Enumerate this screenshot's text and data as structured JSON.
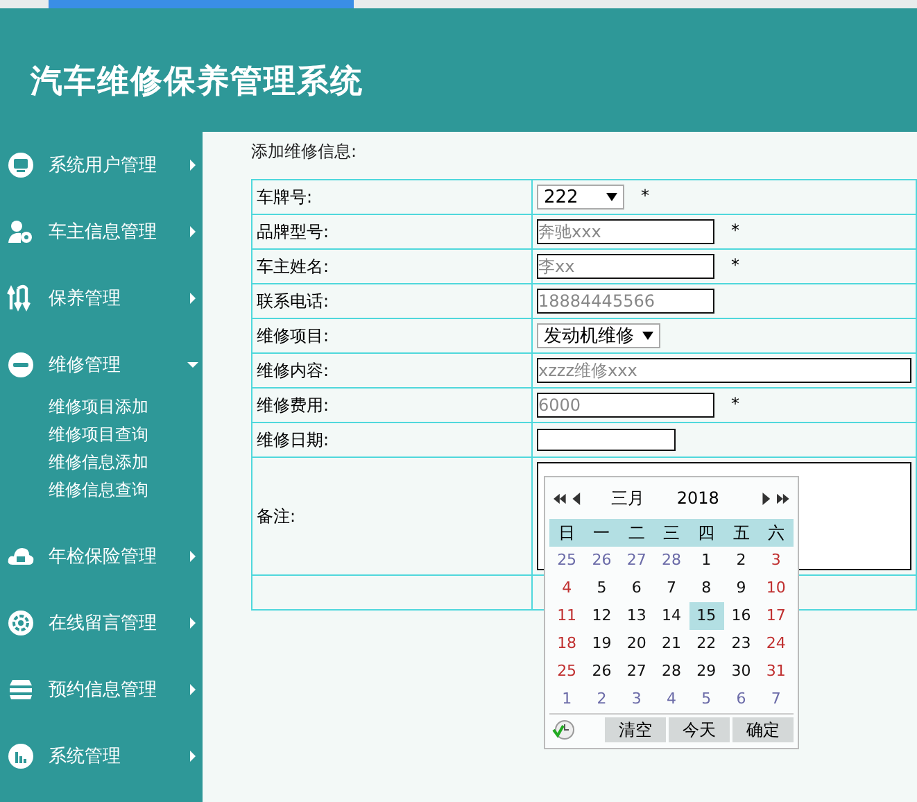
{
  "header": {
    "title": "汽车维修保养管理系统"
  },
  "sidebar": {
    "items": [
      {
        "label": "系统用户管理",
        "expanded": false
      },
      {
        "label": "车主信息管理",
        "expanded": false
      },
      {
        "label": "保养管理",
        "expanded": false
      },
      {
        "label": "维修管理",
        "expanded": true,
        "children": [
          "维修项目添加",
          "维修项目查询",
          "维修信息添加",
          "维修信息查询"
        ]
      },
      {
        "label": "年检保险管理",
        "expanded": false
      },
      {
        "label": "在线留言管理",
        "expanded": false
      },
      {
        "label": "预约信息管理",
        "expanded": false
      },
      {
        "label": "系统管理",
        "expanded": false
      }
    ]
  },
  "form": {
    "heading": "添加维修信息:",
    "rows": [
      {
        "label": "车牌号:",
        "kind": "select",
        "value": "222",
        "mark": "*"
      },
      {
        "label": "品牌型号:",
        "kind": "text",
        "placeholder": "奔驰xxx",
        "mark": "*"
      },
      {
        "label": "车主姓名:",
        "kind": "text",
        "placeholder": "李xx",
        "mark": "*"
      },
      {
        "label": "联系电话:",
        "kind": "text",
        "placeholder": "18884445566"
      },
      {
        "label": "维修项目:",
        "kind": "select",
        "value": "发动机维修"
      },
      {
        "label": "维修内容:",
        "kind": "wide",
        "placeholder": "xzzz维修xxx"
      },
      {
        "label": "维修费用:",
        "kind": "text",
        "placeholder": "6000",
        "mark": "*"
      },
      {
        "label": "维修日期:",
        "kind": "date"
      },
      {
        "label": "备注:",
        "kind": "textarea"
      },
      {
        "kind": "empty"
      }
    ]
  },
  "calendar": {
    "month": "三月",
    "year": "2018",
    "weekdays": [
      "日",
      "一",
      "二",
      "三",
      "四",
      "五",
      "六"
    ],
    "days": [
      {
        "text": "25",
        "kind": "other",
        "selected": false
      },
      {
        "text": "26",
        "kind": "other",
        "selected": false
      },
      {
        "text": "27",
        "kind": "other",
        "selected": false
      },
      {
        "text": "28",
        "kind": "other",
        "selected": false
      },
      {
        "text": "1",
        "kind": "day",
        "selected": false
      },
      {
        "text": "2",
        "kind": "day",
        "selected": false
      },
      {
        "text": "3",
        "kind": "weekend",
        "selected": false
      },
      {
        "text": "4",
        "kind": "weekend",
        "selected": false
      },
      {
        "text": "5",
        "kind": "day",
        "selected": false
      },
      {
        "text": "6",
        "kind": "day",
        "selected": false
      },
      {
        "text": "7",
        "kind": "day",
        "selected": false
      },
      {
        "text": "8",
        "kind": "day",
        "selected": false
      },
      {
        "text": "9",
        "kind": "day",
        "selected": false
      },
      {
        "text": "10",
        "kind": "weekend",
        "selected": false
      },
      {
        "text": "11",
        "kind": "weekend",
        "selected": false
      },
      {
        "text": "12",
        "kind": "day",
        "selected": false
      },
      {
        "text": "13",
        "kind": "day",
        "selected": false
      },
      {
        "text": "14",
        "kind": "day",
        "selected": false
      },
      {
        "text": "15",
        "kind": "day",
        "selected": true
      },
      {
        "text": "16",
        "kind": "day",
        "selected": false
      },
      {
        "text": "17",
        "kind": "weekend",
        "selected": false
      },
      {
        "text": "18",
        "kind": "weekend",
        "selected": false
      },
      {
        "text": "19",
        "kind": "day",
        "selected": false
      },
      {
        "text": "20",
        "kind": "day",
        "selected": false
      },
      {
        "text": "21",
        "kind": "day",
        "selected": false
      },
      {
        "text": "22",
        "kind": "day",
        "selected": false
      },
      {
        "text": "23",
        "kind": "day",
        "selected": false
      },
      {
        "text": "24",
        "kind": "weekend",
        "selected": false
      },
      {
        "text": "25",
        "kind": "weekend",
        "selected": false
      },
      {
        "text": "26",
        "kind": "day",
        "selected": false
      },
      {
        "text": "27",
        "kind": "day",
        "selected": false
      },
      {
        "text": "28",
        "kind": "day",
        "selected": false
      },
      {
        "text": "29",
        "kind": "day",
        "selected": false
      },
      {
        "text": "30",
        "kind": "day",
        "selected": false
      },
      {
        "text": "31",
        "kind": "weekend",
        "selected": false
      },
      {
        "text": "1",
        "kind": "other",
        "selected": false
      },
      {
        "text": "2",
        "kind": "other",
        "selected": false
      },
      {
        "text": "3",
        "kind": "other",
        "selected": false
      },
      {
        "text": "4",
        "kind": "other",
        "selected": false
      },
      {
        "text": "5",
        "kind": "other",
        "selected": false
      },
      {
        "text": "6",
        "kind": "other",
        "selected": false
      },
      {
        "text": "7",
        "kind": "other",
        "selected": false
      }
    ],
    "buttons": [
      "清空",
      "今天",
      "确定"
    ]
  }
}
